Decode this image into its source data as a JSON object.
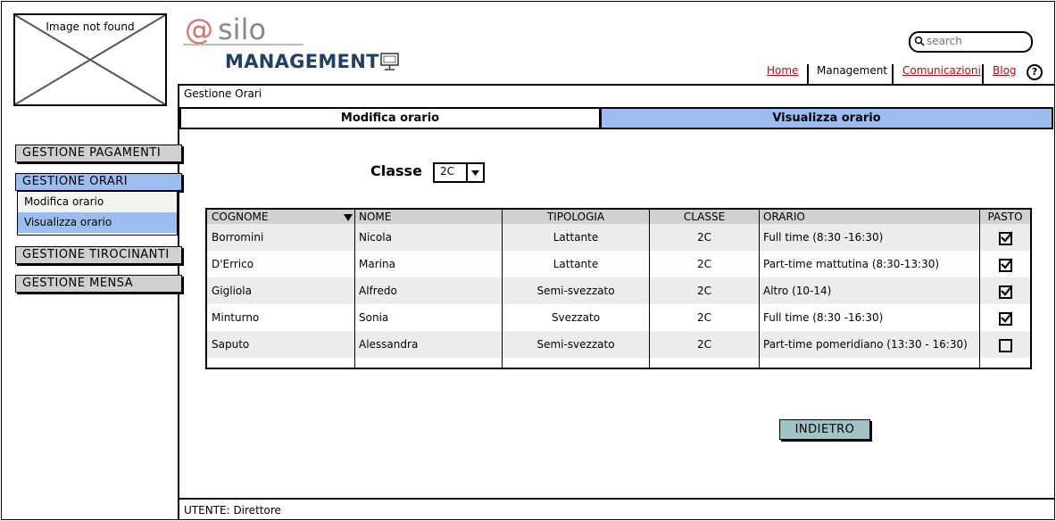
{
  "placeholder_image": {
    "text": "Image not found"
  },
  "logo": {
    "at": "@",
    "silo": "silo",
    "subtitle": "MANAGEMENT",
    "icon": "monitor-icon"
  },
  "search": {
    "placeholder": "search"
  },
  "nav": {
    "home": "Home",
    "management": "Management",
    "comunicazioni": "Comunicazioni",
    "blog": "Blog",
    "help": "?"
  },
  "breadcrumb": "Gestione Orari",
  "tabs": {
    "edit": "Modifica orario",
    "view": "Visualizza orario"
  },
  "sidebar": {
    "pagamenti": "GESTIONE PAGAMENTI",
    "orari": "GESTIONE ORARI",
    "sub_modifica": "Modifica orario",
    "sub_visualizza": "Visualizza orario",
    "tirocinanti": "GESTIONE TIROCINANTI",
    "mensa": "GESTIONE MENSA"
  },
  "filter": {
    "label": "Classe",
    "value": "2C"
  },
  "table": {
    "headers": [
      "COGNOME",
      "NOME",
      "TIPOLOGIA",
      "CLASSE",
      "ORARIO",
      "PASTO"
    ],
    "rows": [
      {
        "cognome": "Borromini",
        "nome": "Nicola",
        "tipologia": "Lattante",
        "classe": "2C",
        "orario": "Full time (8:30 -16:30)",
        "pasto": true
      },
      {
        "cognome": "D'Errico",
        "nome": "Marina",
        "tipologia": "Lattante",
        "classe": "2C",
        "orario": "Part-time mattutina (8:30-13:30)",
        "pasto": true
      },
      {
        "cognome": "Gigliola",
        "nome": "Alfredo",
        "tipologia": "Semi-svezzato",
        "classe": "2C",
        "orario": "Altro (10-14)",
        "pasto": true
      },
      {
        "cognome": "Minturno",
        "nome": "Sonia",
        "tipologia": "Svezzato",
        "classe": "2C",
        "orario": "Full time (8:30 -16:30)",
        "pasto": true
      },
      {
        "cognome": "Saputo",
        "nome": "Alessandra",
        "tipologia": "Semi-svezzato",
        "classe": "2C",
        "orario": "Part-time pomeridiano (13:30 - 16:30)",
        "pasto": false
      }
    ]
  },
  "back_button": "INDIETRO",
  "footer": "UTENTE: Direttore",
  "colors": {
    "accent_blue": "#9bbdf0",
    "logo_at": "#d8706a",
    "logo_mgmt": "#1f3f66",
    "link": "#a31515",
    "button": "#9fc3c7"
  }
}
